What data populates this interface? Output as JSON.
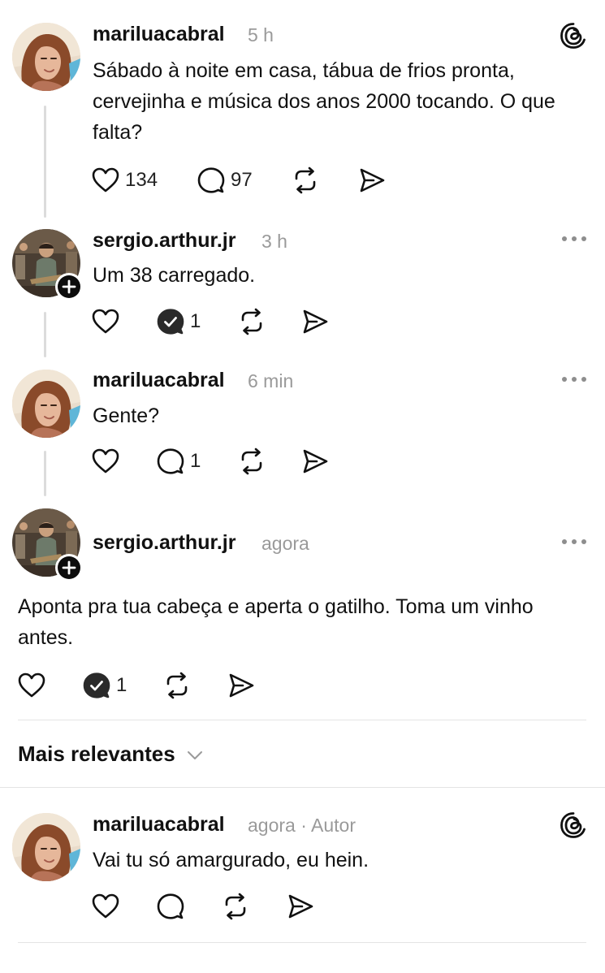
{
  "posts": [
    {
      "username": "mariluacabral",
      "time": "5 h",
      "text": "Sábado à noite em casa, tábua de frios pronta, cervejinha e música dos anos 2000 tocando. O que falta?",
      "likes": "134",
      "replies": "97",
      "top_icon": "threads-logo-icon"
    },
    {
      "username": "sergio.arthur.jr",
      "time": "3 h",
      "text": "Um 38 carregado.",
      "replies": "1",
      "top_icon": "more-icon"
    },
    {
      "username": "mariluacabral",
      "time": "6 min",
      "text": "Gente?",
      "replies": "1",
      "top_icon": "more-icon"
    },
    {
      "username": "sergio.arthur.jr",
      "time": "agora",
      "text": "Aponta pra tua cabeça e aperta o gatilho. Toma um vinho antes.",
      "replies": "1",
      "top_icon": "more-icon"
    }
  ],
  "sort": {
    "label": "Mais relevantes",
    "icon": "chevron-down-icon"
  },
  "reply": {
    "username": "mariluacabral",
    "time": "agora",
    "separator": "·",
    "author_tag": "Autor",
    "text": "Vai tu só amargurado, eu hein.",
    "top_icon": "threads-logo-icon"
  },
  "colors": {
    "text": "#111111",
    "muted": "#9a9a9a",
    "line": "#dcdcdc"
  }
}
